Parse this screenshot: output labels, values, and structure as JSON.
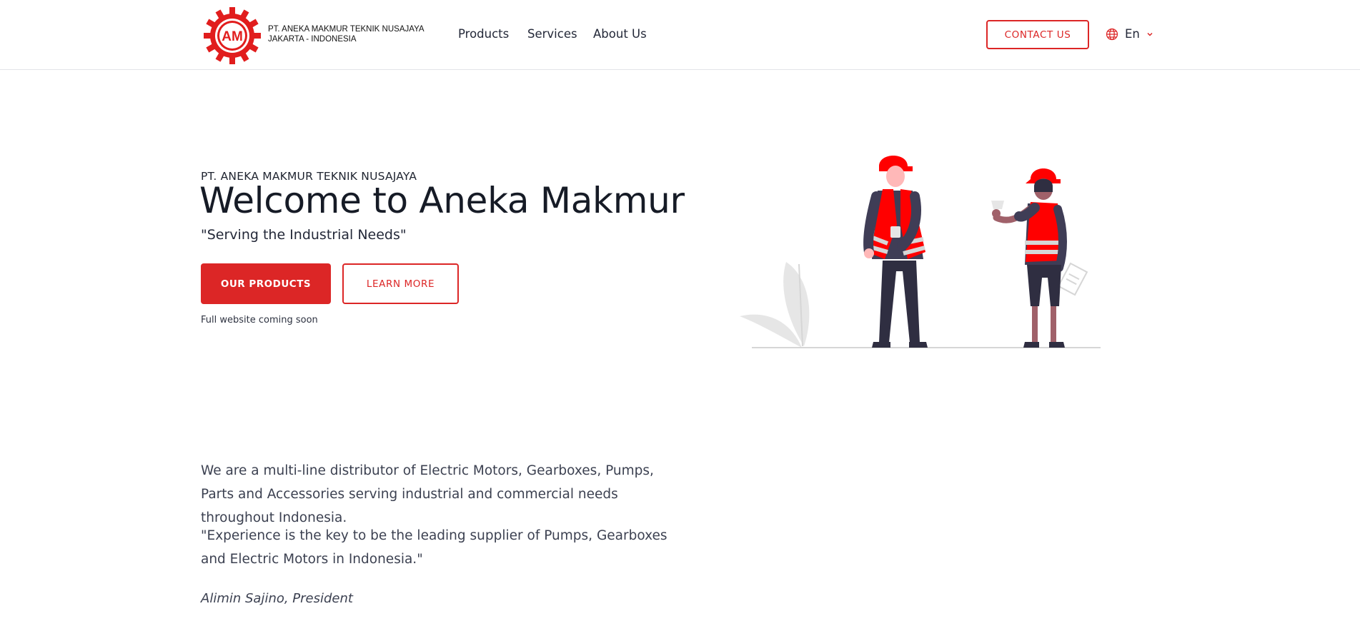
{
  "header": {
    "company_line1": "PT. ANEKA MAKMUR TEKNIK NUSAJAYA",
    "company_line2": "JAKARTA - INDONESIA",
    "logo_text": "AM",
    "nav": {
      "products": "Products",
      "services": "Services",
      "about": "About Us"
    },
    "contact_label": "CONTACT US",
    "language": "En"
  },
  "hero": {
    "eyebrow": "PT. ANEKA MAKMUR TEKNIK NUSAJAYA",
    "title": "Welcome to Aneka Makmur",
    "tagline": "\"Serving the Industrial Needs\"",
    "primary_button": "OUR PRODUCTS",
    "secondary_button": "LEARN MORE",
    "note": "Full website coming soon"
  },
  "about": {
    "paragraph1": "We are a multi-line distributor of Electric Motors, Gearboxes, Pumps, Parts and Accessories serving industrial and commercial needs throughout Indonesia.",
    "paragraph2": "\"Experience is the key to be the leading supplier of Pumps, Gearboxes and Electric Motors in Indonesia.\"",
    "signature": "Alimin Sajino, President"
  },
  "icons": {
    "logo": "gear-logo-icon",
    "language": "globe-icon",
    "dropdown": "chevron-down-icon"
  },
  "colors": {
    "accent": "#dc2626",
    "text_dark": "#161b26",
    "text_body": "#3c4151"
  }
}
